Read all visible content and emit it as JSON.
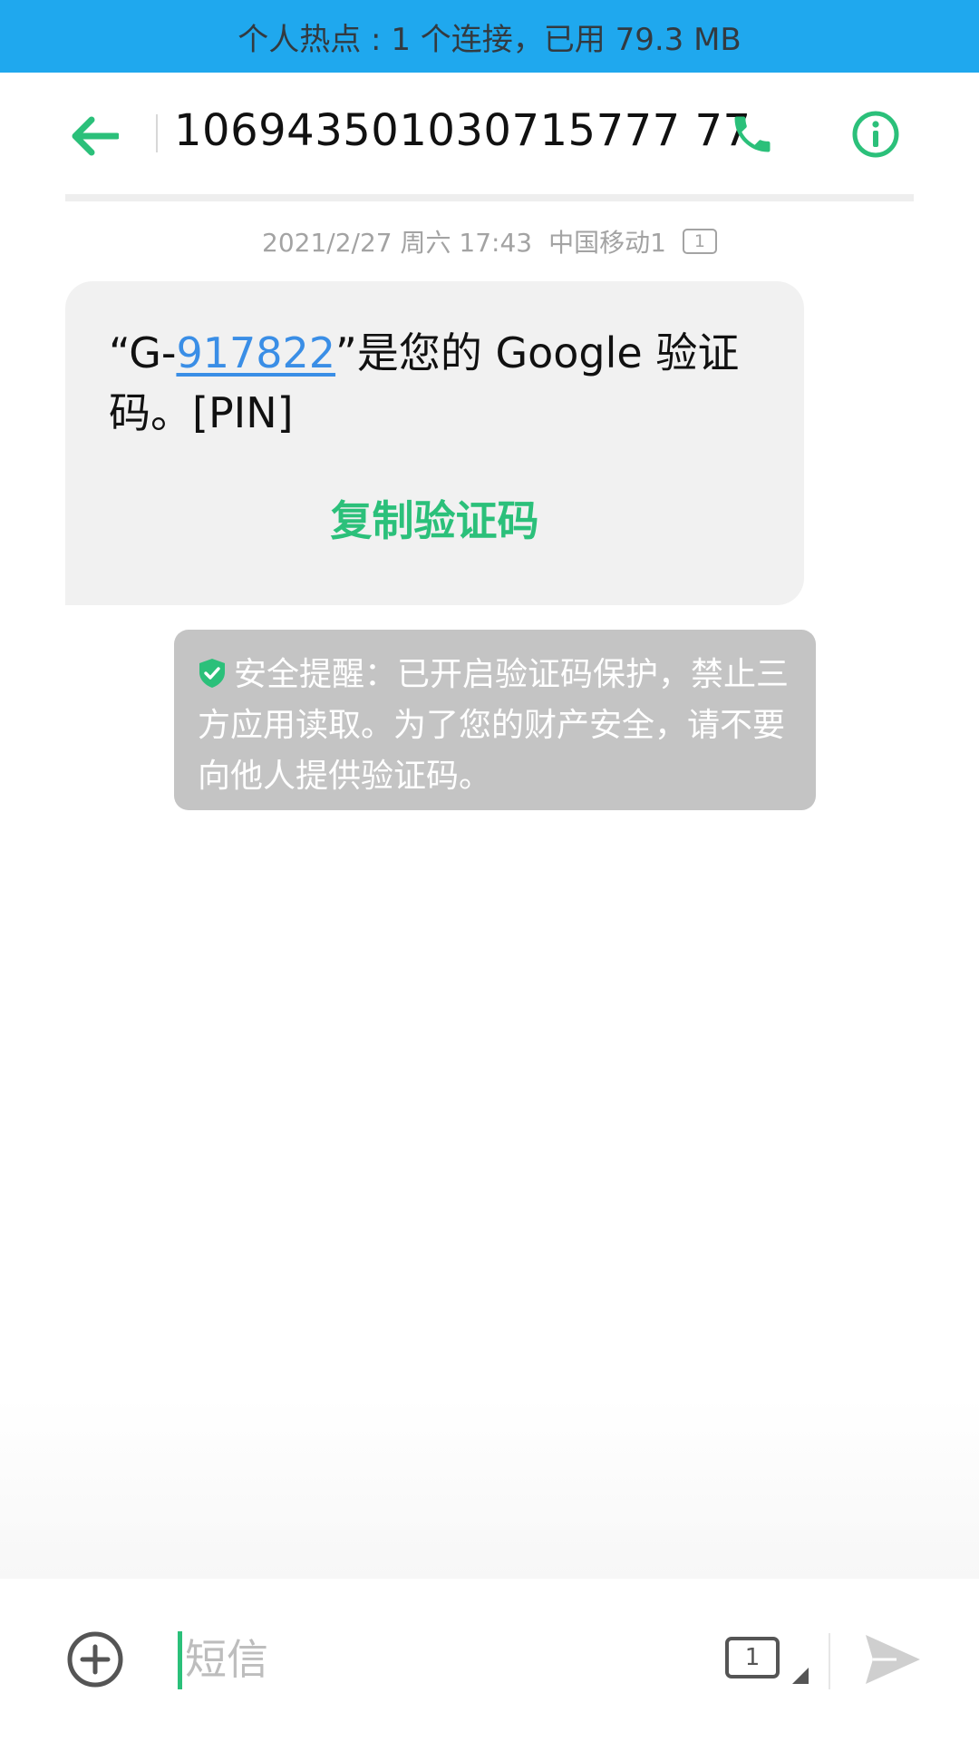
{
  "status_bar": {
    "hotspot_text": "个人热点 : 1 个连接，已用 79.3 MB"
  },
  "header": {
    "sender": "106943501030715777 77",
    "back_icon": "arrow-left-icon",
    "call_icon": "phone-icon",
    "info_icon": "info-icon"
  },
  "conversation": {
    "meta": {
      "datetime": "2021/2/27 周六 17:43",
      "carrier": "中国移动1",
      "sim": "1"
    },
    "message": {
      "prefix": "“G-",
      "code": "917822",
      "suffix": "”是您的 Google 验证码。[PIN]",
      "copy_label": "复制验证码"
    },
    "security_notice": {
      "shield_icon": "shield-check-icon",
      "text": "安全提醒：已开启验证码保护，禁止三方应用读取。为了您的财产安全，请不要向他人提供验证码。"
    }
  },
  "composer": {
    "add_icon": "plus-circle-icon",
    "placeholder": "短信",
    "sim": "1",
    "send_icon": "send-icon"
  },
  "colors": {
    "accent": "#2bc07a",
    "hotspot_bar": "#1fa8ee",
    "link": "#3a8ee6",
    "notice_bg": "#c4c4c4",
    "bubble_bg": "#f1f1f1"
  }
}
